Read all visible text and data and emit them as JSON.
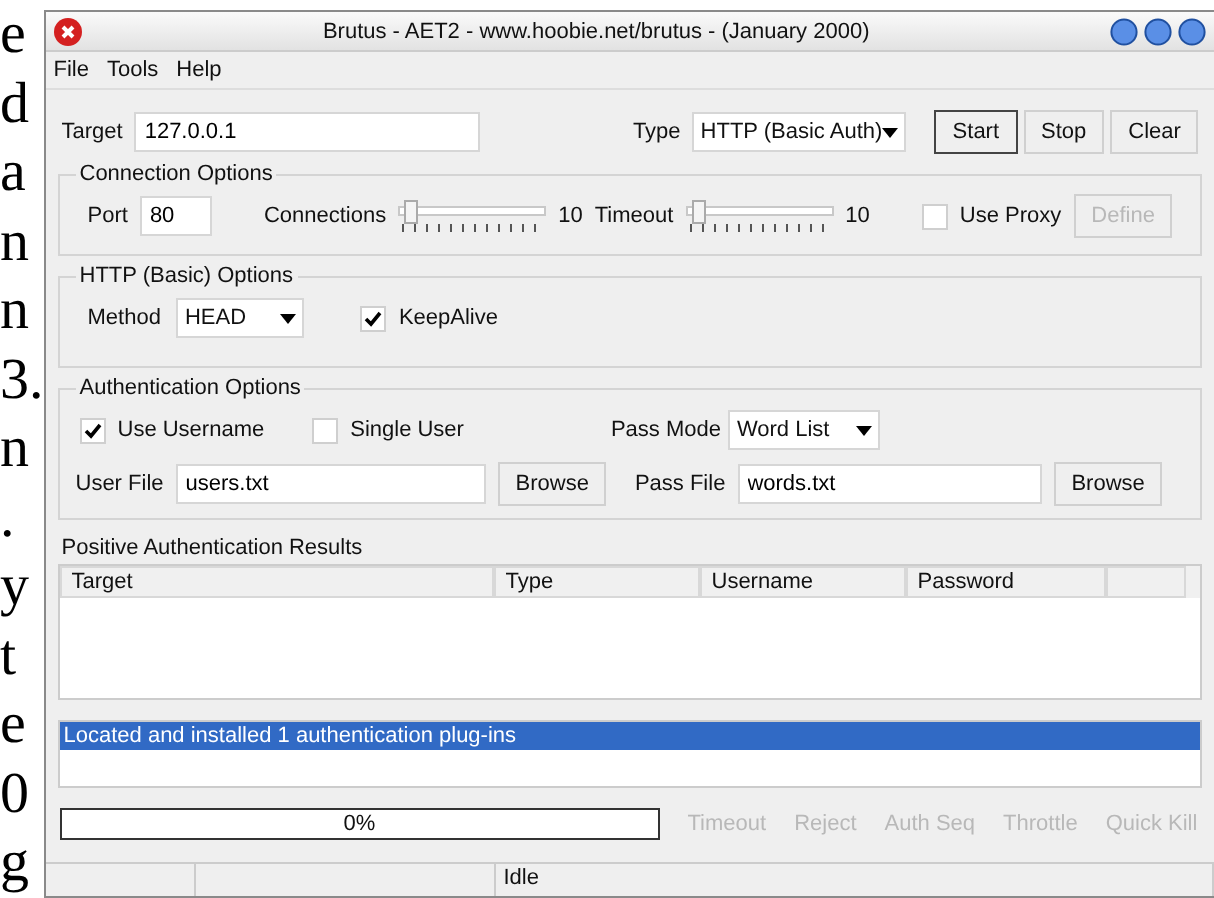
{
  "background_page": {
    "letters": [
      "e",
      "d",
      "a",
      "n",
      "n",
      "3.",
      "n",
      ".",
      "y",
      "t",
      "e",
      "0",
      "g"
    ]
  },
  "window": {
    "title": "Brutus - AET2 - www.hoobie.net/brutus - (January 2000)"
  },
  "menu": [
    "File",
    "Tools",
    "Help"
  ],
  "target": {
    "label": "Target",
    "value": "127.0.0.1"
  },
  "type": {
    "label": "Type",
    "value": "HTTP (Basic Auth)"
  },
  "actions": [
    {
      "label": "Start",
      "default": true
    },
    {
      "label": "Stop",
      "default": false
    },
    {
      "label": "Clear",
      "default": false
    }
  ],
  "connection_options": {
    "title": "Connection Options",
    "port_label": "Port",
    "port": "80",
    "connections": {
      "label": "Connections",
      "level": 0.05,
      "reading": "10"
    },
    "timeout": {
      "label": "Timeout",
      "level": 0.05,
      "reading": "10"
    },
    "use_proxy": {
      "label": "Use Proxy",
      "checked": false
    },
    "define": {
      "label": "Define",
      "disabled": true
    }
  },
  "http_options": {
    "title": "HTTP (Basic) Options",
    "method_label": "Method",
    "method": "HEAD",
    "keepalive": {
      "label": "KeepAlive",
      "checked": true
    }
  },
  "auth_options": {
    "title": "Authentication Options",
    "use_username": {
      "label": "Use Username",
      "checked": true
    },
    "single_user": {
      "label": "Single User",
      "checked": false
    },
    "pass_mode_label": "Pass Mode",
    "pass_mode": "Word List",
    "user_file_label": "User File",
    "user_file": "users.txt",
    "pass_file_label": "Pass File",
    "pass_file": "words.txt",
    "user_browse": "Browse",
    "pass_browse": "Browse"
  },
  "results": {
    "title": "Positive Authentication Results",
    "columns": [
      "Target",
      "Type",
      "Username",
      "Password"
    ]
  },
  "log": [
    {
      "text": "Located and installed 1 authentication plug-ins",
      "selected": true
    }
  ],
  "progress": {
    "reading": "0%"
  },
  "counters": [
    {
      "label": "Timeout",
      "disabled": true
    },
    {
      "label": "Reject",
      "disabled": true
    },
    {
      "label": "Auth Seq",
      "disabled": true
    },
    {
      "label": "Throttle",
      "disabled": true
    },
    {
      "label": "Quick Kill",
      "disabled": true
    }
  ],
  "status_bar": {
    "text": "Idle"
  }
}
